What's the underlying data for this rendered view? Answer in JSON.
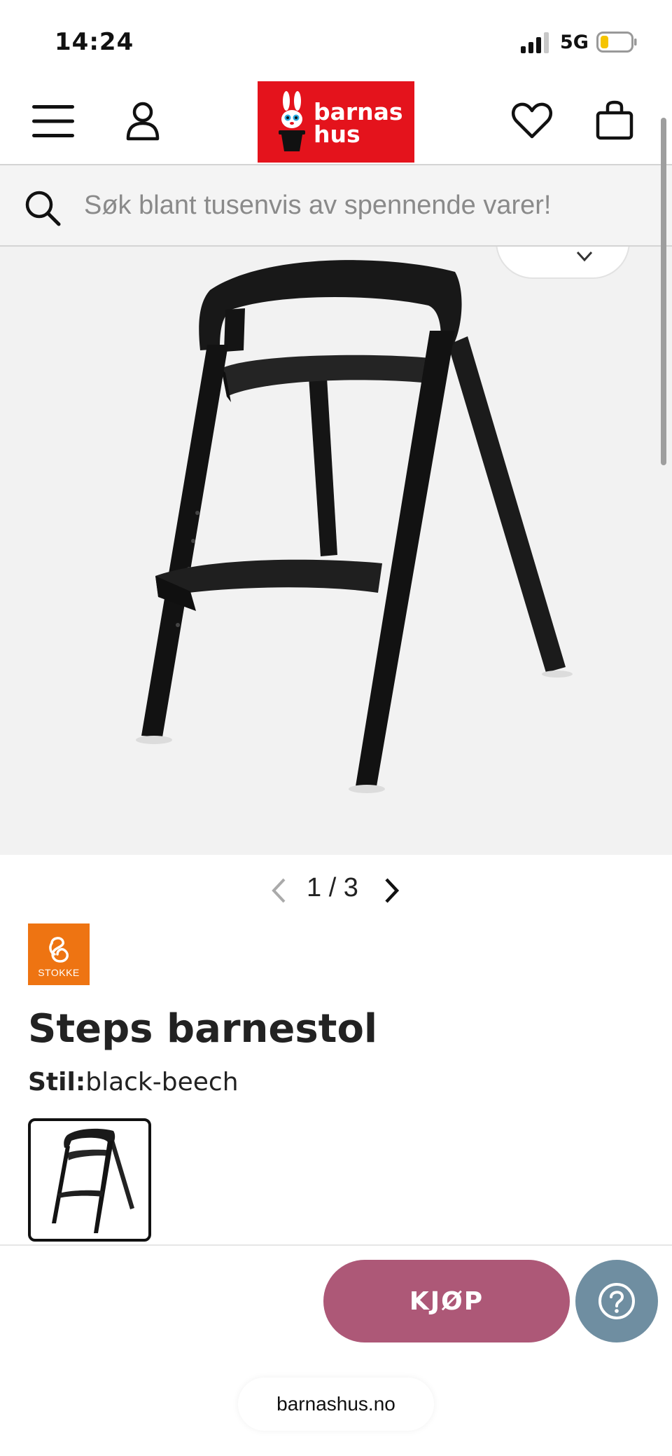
{
  "status_bar": {
    "time": "14:24",
    "network": "5G",
    "battery_color": "#f5c400"
  },
  "header": {
    "menu_icon": "hamburger-menu-icon",
    "account_icon": "user-icon",
    "logo_text": "barnas hus",
    "logo_color": "#e4131c",
    "wishlist_icon": "heart-icon",
    "cart_icon": "shopping-bag-icon"
  },
  "search": {
    "icon": "search-icon",
    "placeholder": "Søk blant tusenvis av spennende varer!"
  },
  "gallery": {
    "pager_text": "1 / 3",
    "prev_icon": "chevron-left-icon",
    "next_icon": "chevron-right-icon"
  },
  "product": {
    "brand": "STOKKE",
    "brand_color": "#ee7412",
    "title": "Steps barnestol",
    "style_label": "Stil:",
    "style_value": "black-beech"
  },
  "actions": {
    "buy_label": "KJØP",
    "buy_color": "#ad5877",
    "help_icon": "question-mark-icon",
    "help_color": "#6f8ea1"
  },
  "browser": {
    "url": "barnashus.no"
  }
}
